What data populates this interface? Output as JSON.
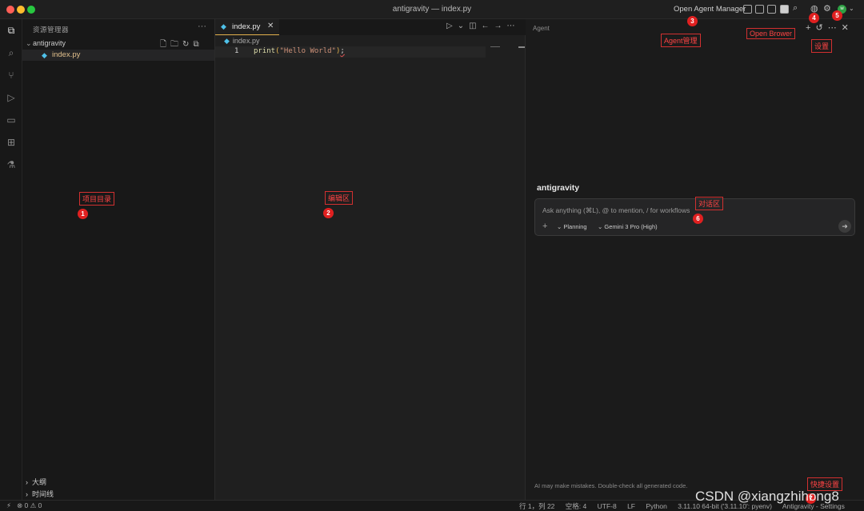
{
  "window": {
    "title": "antigravity — index.py"
  },
  "titlebar": {
    "agent_manager": "Open Agent Manager",
    "avatar_initial": "w"
  },
  "sidebar": {
    "title": "资源管理器",
    "more": "···",
    "folder": "antigravity",
    "file": "index.py",
    "outline": "大纲",
    "timeline": "时间线"
  },
  "editor": {
    "tab_label": "index.py",
    "tab_close": "✕",
    "breadcrumb": "index.py",
    "line_number": "1",
    "code": {
      "func": "print",
      "open": "(",
      "string": "\"Hello World\"",
      "close": ")",
      "semi": ";"
    }
  },
  "agent": {
    "title": "Agent",
    "project": "antigravity",
    "input_placeholder": "Ask anything (⌘L), @ to mention, / for workflows",
    "mode": "Planning",
    "model": "Gemini 3 Pro (High)",
    "disclaimer": "AI may make mistakes. Double-check all generated code."
  },
  "statusbar": {
    "problems": "⊗ 0 ⚠ 0",
    "position": "行 1，列 22",
    "spaces": "空格: 4",
    "encoding": "UTF-8",
    "eol": "LF",
    "language": "Python",
    "interpreter": "3.11.10 64-bit ('3.11.10': pyenv)",
    "app": "Antigravity - Settings"
  },
  "annotations": {
    "n1": {
      "label": "项目目录",
      "num": "1"
    },
    "n2": {
      "label": "编辑区",
      "num": "2"
    },
    "n3": {
      "label": "Agent管理",
      "num": "3"
    },
    "n4": {
      "label": "Open Brower",
      "num": "4"
    },
    "n5": {
      "label": "设置",
      "num": "5"
    },
    "n6": {
      "label": "对话区",
      "num": "6"
    },
    "n7": {
      "label": "快捷设置",
      "num": "7"
    }
  },
  "watermark": "CSDN @xiangzhihong8",
  "colors": {
    "accent_tab": "#e2b14d",
    "python_icon": "#4fc1e9",
    "annotation": "#e02020"
  }
}
